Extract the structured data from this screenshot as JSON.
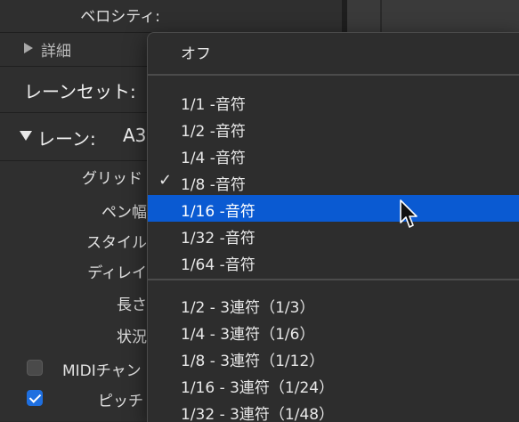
{
  "inspector": {
    "velocity_label": "ベロシティ:",
    "details_label": "詳細",
    "lane_set_label": "レーンセット:",
    "lane_label": "レーン:",
    "lane_value": "A3",
    "grid_label": "グリッド",
    "pen_width_label": "ペン幅",
    "style_label": "スタイル",
    "delay_label": "ディレイ",
    "length_label": "長さ",
    "status_label": "状況",
    "midi_channel_label": "MIDIチャン",
    "pitch_label": "ピッチ",
    "midi_channel_checked": false,
    "pitch_checked": true
  },
  "menu": {
    "off": "オフ",
    "notes": [
      {
        "label": "1/1 -音符",
        "checked": false,
        "selected": false
      },
      {
        "label": "1/2 -音符",
        "checked": false,
        "selected": false
      },
      {
        "label": "1/4 -音符",
        "checked": false,
        "selected": false
      },
      {
        "label": "1/8 -音符",
        "checked": true,
        "selected": false
      },
      {
        "label": "1/16 -音符",
        "checked": false,
        "selected": true
      },
      {
        "label": "1/32 -音符",
        "checked": false,
        "selected": false
      },
      {
        "label": "1/64 -音符",
        "checked": false,
        "selected": false
      }
    ],
    "triplets": [
      {
        "label": "1/2 - 3連符（1/3）"
      },
      {
        "label": "1/4 - 3連符（1/6）"
      },
      {
        "label": "1/8 - 3連符（1/12）"
      },
      {
        "label": "1/16 - 3連符（1/24）"
      },
      {
        "label": "1/32 - 3連符（1/48）"
      }
    ],
    "check_glyph": "✓"
  },
  "colors": {
    "selection": "#0a5ad2",
    "checkbox_on": "#1e6fe0"
  }
}
